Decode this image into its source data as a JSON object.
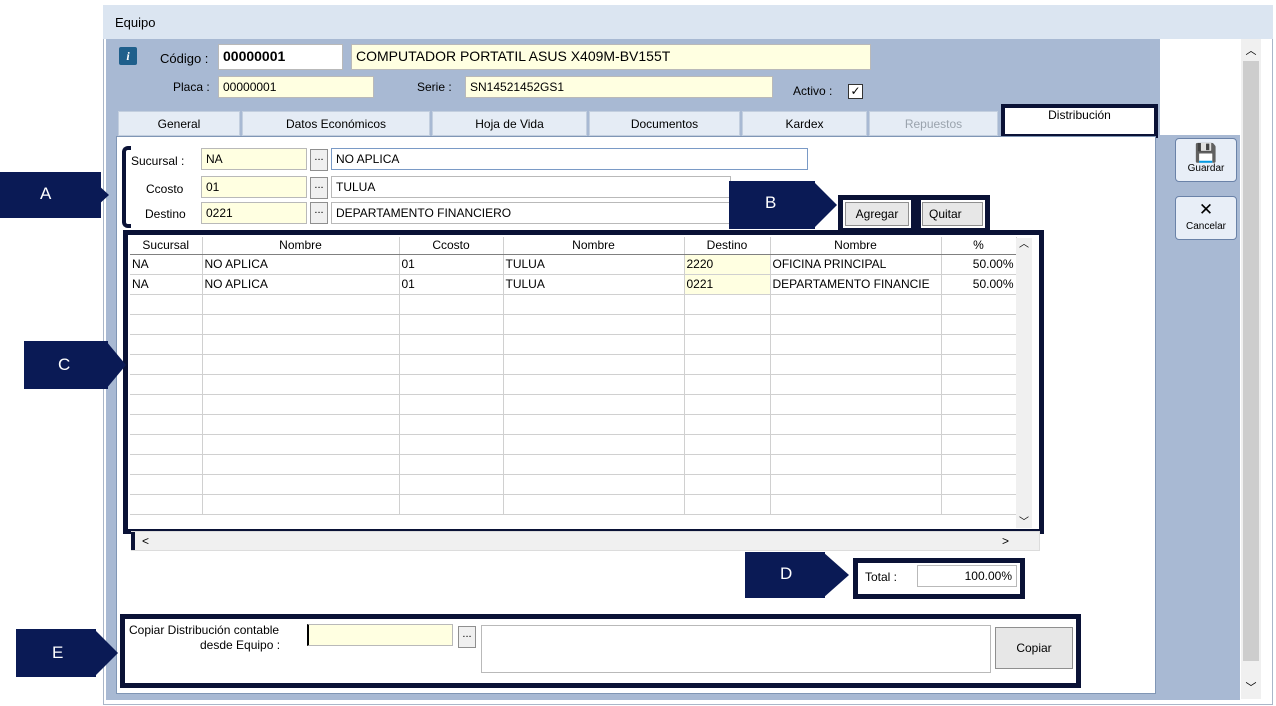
{
  "window": {
    "title": "Equipo"
  },
  "header": {
    "codigo_label": "Código :",
    "codigo_value": "00000001",
    "descripcion": "COMPUTADOR PORTATIL ASUS X409M-BV155T",
    "placa_label": "Placa :",
    "placa_value": "00000001",
    "serie_label": "Serie :",
    "serie_value": "SN14521452GS1",
    "activo_label": "Activo :",
    "activo_checked": true
  },
  "tabs": [
    {
      "label": "General"
    },
    {
      "label": "Datos Económicos"
    },
    {
      "label": "Hoja de Vida"
    },
    {
      "label": "Documentos"
    },
    {
      "label": "Kardex"
    },
    {
      "label": "Repuestos"
    },
    {
      "label": "Distribución"
    }
  ],
  "form": {
    "sucursal_label": "Sucursal :",
    "sucursal_code": "NA",
    "sucursal_name": "NO APLICA",
    "ccosto_label": "Ccosto",
    "ccosto_code": "01",
    "ccosto_name": "TULUA",
    "destino_label": "Destino",
    "destino_code": "0221",
    "destino_name": "DEPARTAMENTO FINANCIERO",
    "agregar_label": "Agregar",
    "quitar_label": "Quitar",
    "dots": "..."
  },
  "grid": {
    "columns": [
      "Sucursal",
      "Nombre",
      "Ccosto",
      "Nombre",
      "Destino",
      "Nombre",
      "%"
    ],
    "rows": [
      [
        "NA",
        "NO APLICA",
        "01",
        "TULUA",
        "2220",
        "OFICINA PRINCIPAL",
        "50.00%"
      ],
      [
        "NA",
        "NO APLICA",
        "01",
        "TULUA",
        "0221",
        "DEPARTAMENTO FINANCIE",
        "50.00%"
      ]
    ],
    "scroll_left": "<",
    "scroll_right": ">"
  },
  "total": {
    "label": "Total :",
    "value": "100.00%"
  },
  "copiar": {
    "label_line1": "Copiar Distribución contable",
    "label_line2": "desde Equipo :",
    "input_value": "",
    "name_value": "",
    "button_label": "Copiar"
  },
  "side_buttons": {
    "guardar": "Guardar",
    "cancelar": "Cancelar"
  },
  "callouts": {
    "a": "A",
    "b": "B",
    "c": "C",
    "d": "D",
    "e": "E"
  },
  "colors": {
    "callout": "#0a1a55",
    "frame": "#a8b9d3",
    "yellow_field": "#ffffe1"
  }
}
